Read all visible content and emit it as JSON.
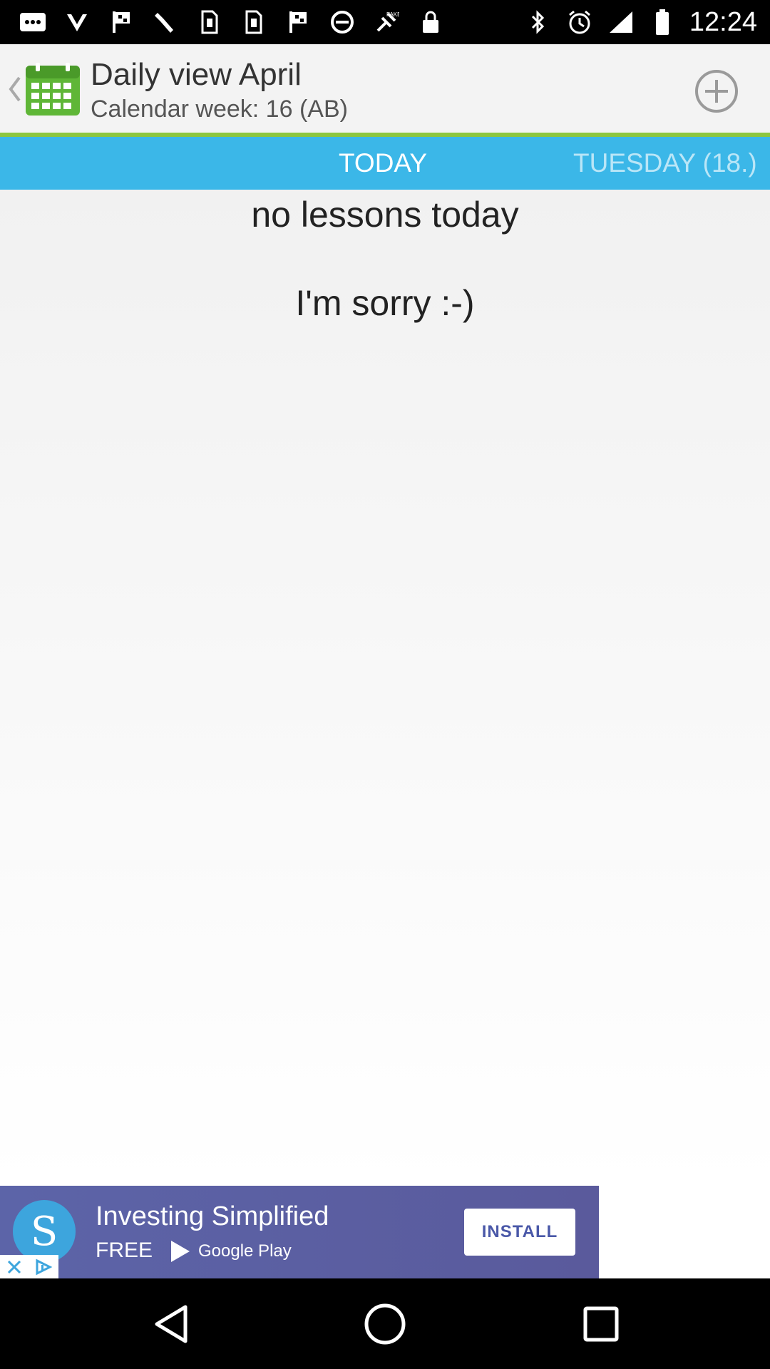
{
  "status_bar": {
    "time": "12:24",
    "icons_left": [
      "message-icon",
      "check-icon",
      "flag-icon",
      "wrench-icon",
      "sim-icon",
      "sim-icon",
      "flag-icon",
      "circle-icon",
      "fake-gps-icon",
      "lock-icon"
    ],
    "icons_right": [
      "bluetooth-icon",
      "alarm-icon",
      "signal-icon",
      "battery-icon"
    ]
  },
  "header": {
    "title": "Daily view April",
    "subtitle": "Calendar week: 16 (AB)",
    "back_icon": "chevron-left-icon",
    "app_icon": "calendar-icon",
    "add_icon": "plus-circle-icon"
  },
  "tabs": [
    {
      "label": "TODAY",
      "active": true
    },
    {
      "label": "TUESDAY (18.)",
      "active": false
    }
  ],
  "content": {
    "line1": "no lessons today",
    "line2": "I'm sorry :-)"
  },
  "ad": {
    "title": "Investing Simplified",
    "free_label": "FREE",
    "store_label": "Google Play",
    "install_label": "INSTALL",
    "logo_letter": "S"
  },
  "nav": {
    "back_icon": "triangle-back-icon",
    "home_icon": "circle-home-icon",
    "recent_icon": "square-recents-icon"
  },
  "colors": {
    "tab_bar": "#3bb7e8",
    "accent_line": "#8cc63f",
    "ad_background": "#5c64a8"
  }
}
